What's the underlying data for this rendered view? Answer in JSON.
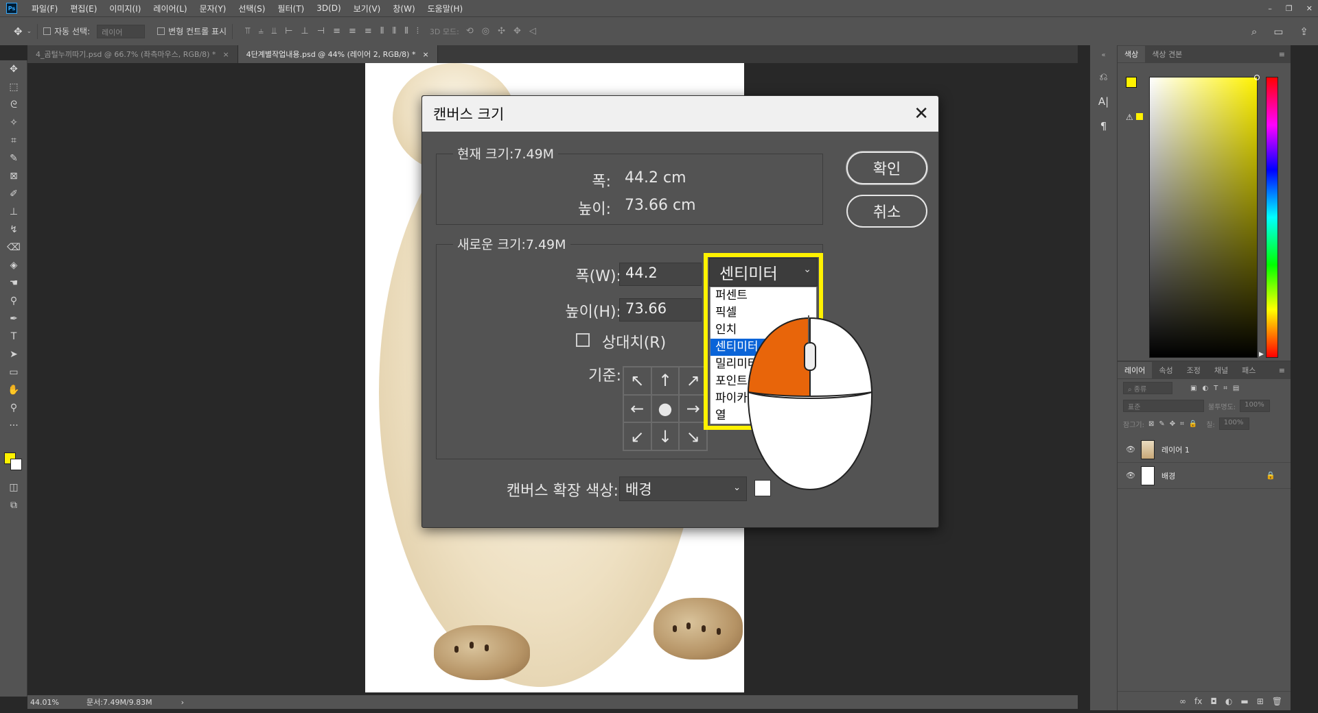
{
  "menubar": {
    "items": [
      "파일(F)",
      "편집(E)",
      "이미지(I)",
      "레이어(L)",
      "문자(Y)",
      "선택(S)",
      "필터(T)",
      "3D(D)",
      "보기(V)",
      "창(W)",
      "도움말(H)"
    ],
    "logo": "Ps",
    "win_min": "–",
    "win_restore": "❐",
    "win_close": "✕"
  },
  "optionsbar": {
    "auto_select_label": "자동 선택:",
    "auto_select_value": "레이어",
    "transform_label": "변형 컨트롤 표시",
    "mode_3d_label": "3D 모드:"
  },
  "tabs": [
    {
      "label": "4_곰털누끼따기.psd @ 66.7% (좌측마우스, RGB/8) *",
      "close": "×"
    },
    {
      "label": "4단계별작업내용.psd @ 44% (레이어 2, RGB/8) *",
      "close": "×"
    }
  ],
  "statusbar": {
    "zoom": "44.01%",
    "doc": "문서:7.49M/9.83M",
    "arrow": "›"
  },
  "color_panel": {
    "tabs": [
      "색상",
      "색상 견본"
    ],
    "fg_color": "#fff200",
    "bg_color": "#ffffff"
  },
  "layers_panel": {
    "tabs": [
      "레이어",
      "속성",
      "조정",
      "채널",
      "패스"
    ],
    "filter_label": "종류",
    "blend_mode": "표준",
    "opacity_label": "불투명도:",
    "opacity_value": "100%",
    "lock_label": "잠그기:",
    "fill_label": "칠:",
    "fill_value": "100%",
    "layers": [
      {
        "name": "레이어 1",
        "visible": true
      },
      {
        "name": "배경",
        "visible": true,
        "locked": true
      }
    ]
  },
  "dialog": {
    "title": "캔버스 크기",
    "close": "✕",
    "current_size_legend": "현재 크기:7.49M",
    "current_width_label": "폭:",
    "current_width_value": "44.2 cm",
    "current_height_label": "높이:",
    "current_height_value": "73.66 cm",
    "new_size_legend": "새로운 크기:7.49M",
    "width_label": "폭(W):",
    "width_value": "44.2",
    "height_label": "높이(H):",
    "height_value": "73.66",
    "relative_label": "상대치(R)",
    "relative_checked": false,
    "anchor_label": "기준:",
    "extension_color_label": "캔버스 확장 색상:",
    "extension_color_value": "배경",
    "extension_swatch": "#ffffff",
    "ok_label": "확인",
    "cancel_label": "취소"
  },
  "unit_dropdown": {
    "selected": "센티미터",
    "options": [
      "퍼센트",
      "픽셀",
      "인치",
      "센티미터",
      "밀리미터",
      "포인트",
      "파이카",
      "열"
    ],
    "highlighted_index": 3,
    "highlight_color": "#fff200"
  },
  "annotation": {
    "mouse_left_button_color": "#e8650a"
  }
}
